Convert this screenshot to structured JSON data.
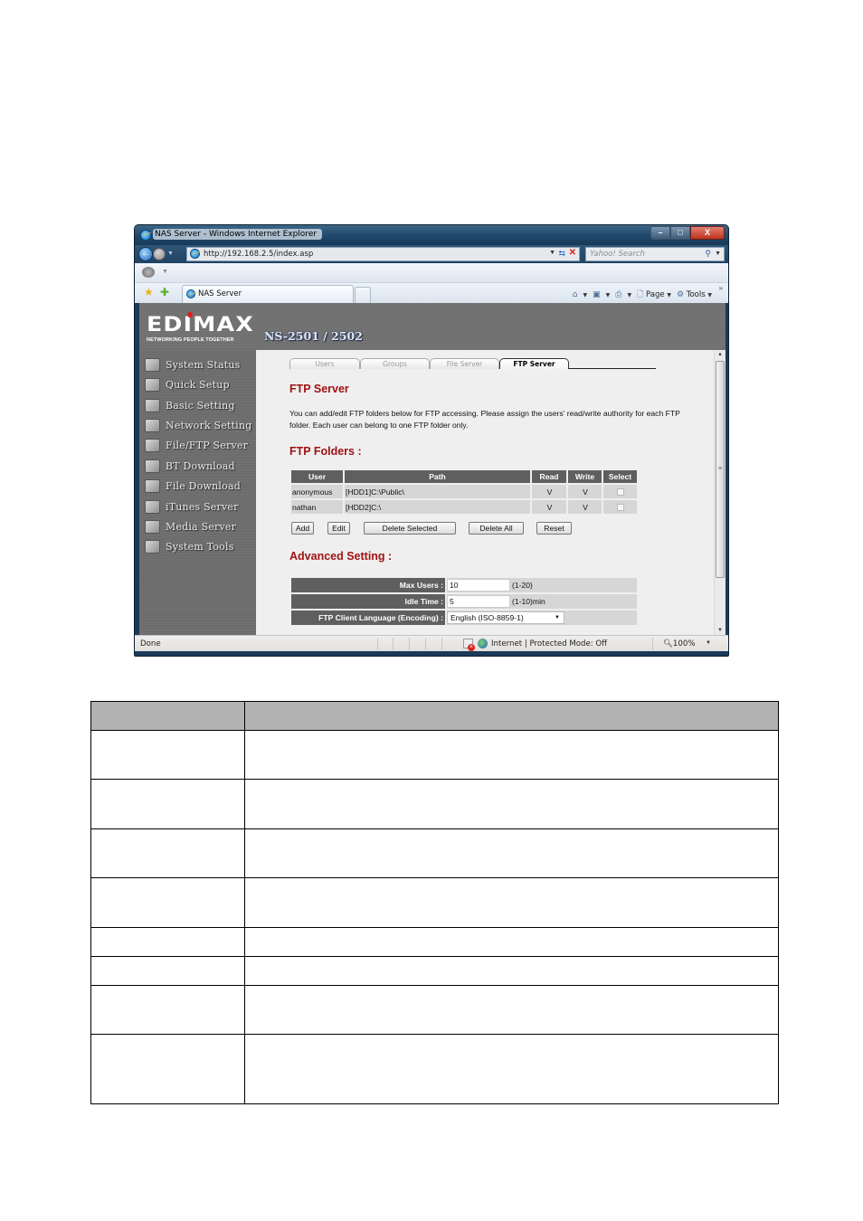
{
  "browser": {
    "window_title": "NAS Server - Windows Internet Explorer",
    "address": "http://192.168.2.5/index.asp",
    "search_placeholder": "Yahoo! Search",
    "tab_title": "NAS Server",
    "window_buttons": {
      "minimize": "–",
      "maximize": "□",
      "close": "X"
    },
    "command_bar": {
      "page_label": "Page",
      "tools_label": "Tools"
    },
    "status": {
      "left": "Done",
      "zone": "Internet | Protected Mode: Off",
      "zoom": "100%"
    }
  },
  "app": {
    "brand": "EDIMAX",
    "tagline": "NETWORKING PEOPLE TOGETHER",
    "model": "NS-2501 / 2502",
    "brand_dot_color": "#e31b1b",
    "sidebar": [
      {
        "label": "System Status",
        "icon": "monitor-icon"
      },
      {
        "label": "Quick Setup",
        "icon": "wizard-icon"
      },
      {
        "label": "Basic Setting",
        "icon": "checklist-icon"
      },
      {
        "label": "Network Setting",
        "icon": "network-icon"
      },
      {
        "label": "File/FTP Server",
        "icon": "folder-icon"
      },
      {
        "label": "BT Download",
        "icon": "bittorrent-icon"
      },
      {
        "label": "File Download",
        "icon": "download-icon"
      },
      {
        "label": "iTunes Server",
        "icon": "music-icon"
      },
      {
        "label": "Media Server",
        "icon": "media-icon"
      },
      {
        "label": "System Tools",
        "icon": "tools-icon"
      }
    ],
    "tabs": [
      {
        "label": "Users",
        "active": false
      },
      {
        "label": "Groups",
        "active": false
      },
      {
        "label": "File Server",
        "active": false
      },
      {
        "label": "FTP Server",
        "active": true
      }
    ],
    "heading": "FTP Server",
    "description": "You can add/edit FTP folders below for FTP accessing. Please assign the users' read/write authority for each FTP folder. Each user can belong to one FTP folder only.",
    "folders_heading": "FTP Folders  :",
    "folders_table": {
      "columns": [
        "User",
        "Path",
        "Read",
        "Write",
        "Select"
      ],
      "rows": [
        {
          "user": "anonymous",
          "path": "[HDD1]C:\\Public\\",
          "read": "V",
          "write": "V",
          "selected": false
        },
        {
          "user": "nathan",
          "path": "[HDD2]C:\\",
          "read": "V",
          "write": "V",
          "selected": false
        }
      ]
    },
    "buttons": {
      "add": "Add",
      "edit": "Edit",
      "delete_selected": "Delete Selected",
      "delete_all": "Delete All",
      "reset": "Reset"
    },
    "advanced_heading": "Advanced Setting  :",
    "advanced": {
      "max_users": {
        "label": "Max Users :",
        "value": "10",
        "hint": "(1-20)"
      },
      "idle_time": {
        "label": "Idle Time :",
        "value": "5",
        "hint": "(1-10)min"
      },
      "language": {
        "label": "FTP Client Language (Encoding) :",
        "value": "English (ISO-8859-1)"
      }
    },
    "accent_color": "#a01212"
  },
  "doc_table": {
    "rows": 8
  }
}
